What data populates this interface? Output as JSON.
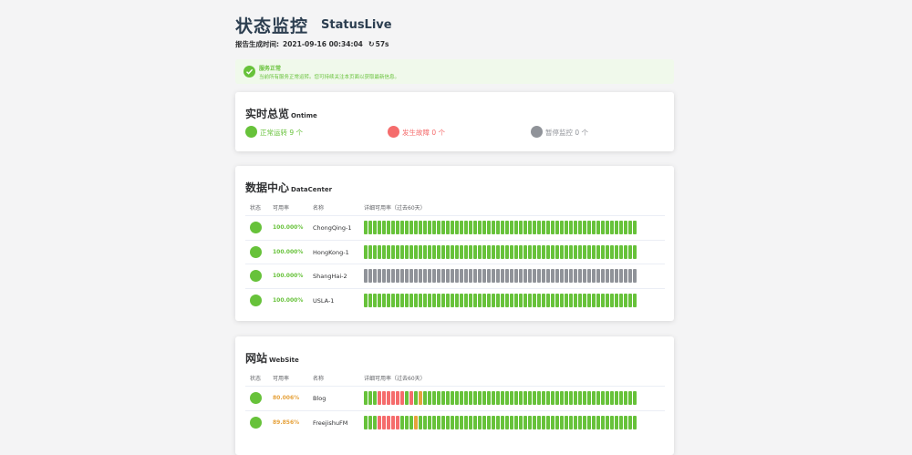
{
  "header": {
    "title": "状态监控",
    "subtitle": "StatusLive",
    "report_label": "报告生成时间:",
    "report_time": "2021-09-16 00:34:04",
    "refresh": "57s"
  },
  "alert": {
    "title": "服务正常",
    "description": "当前所有服务正常运转。您可持续关注本页面以获取最新信息。"
  },
  "overview": {
    "title_zh": "实时总览",
    "title_en": "Ontime",
    "items": [
      {
        "label": "正常运转 9 个",
        "color": "#67c23a"
      },
      {
        "label": "发生故障 0 个",
        "color": "#f56c6c"
      },
      {
        "label": "暂停监控 0 个",
        "color": "#909399"
      }
    ]
  },
  "columns": {
    "status": "状态",
    "uptime": "可用率",
    "name": "名称",
    "detail": "详细可用率（过去60天）"
  },
  "colors": {
    "up": "#67c23a",
    "down": "#f56c6c",
    "paused": "#909399",
    "warn": "#e6a23c"
  },
  "datacenter": {
    "title_zh": "数据中心",
    "title_en": "DataCenter",
    "rows": [
      {
        "uptime": "100.000%",
        "uptime_color": "#67c23a",
        "name": "ChongQing-1",
        "days": "gggggggggggggggggggggggggggggggggggggggggggggggggggggggggggg"
      },
      {
        "uptime": "100.000%",
        "uptime_color": "#67c23a",
        "name": "HongKong-1",
        "days": "gggggggggggggggggggggggggggggggggggggggggggggggggggggggggggg"
      },
      {
        "uptime": "100.000%",
        "uptime_color": "#67c23a",
        "name": "ShangHai-2",
        "days": "pppppppppppppppppppppppppppppppppppppppppppppppppppppppppppp"
      },
      {
        "uptime": "100.000%",
        "uptime_color": "#67c23a",
        "name": "USLA-1",
        "days": "gggggggggggggggggggggggggggggggggggggggggggggggggggggggggggg"
      }
    ]
  },
  "website": {
    "title_zh": "网站",
    "title_en": "WebSite",
    "rows": [
      {
        "uptime": "80.006%",
        "uptime_color": "#e6a23c",
        "name": "Blog",
        "days": "gggrrrrrrgrgoggggggggggggggggggggggggggggggggggggggggggggggg"
      },
      {
        "uptime": "89.856%",
        "uptime_color": "#e6a23c",
        "name": "FreejishuFM",
        "days": "gggrrrrrgggoggggggggggggggggggggggggggggggggggggggggggggggggg"
      }
    ]
  }
}
